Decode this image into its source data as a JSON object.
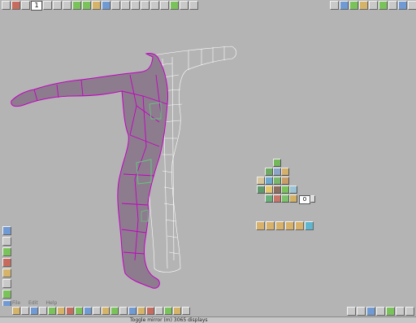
{
  "top_toolbar": {
    "frame_value": "1",
    "right_icons": [
      "perspective-view-icon",
      "camera-icon",
      "paint-icon",
      "render-icon",
      "texture-icon",
      "light-icon",
      "cube-icon",
      "grid-icon",
      "view-icon",
      "settings-icon",
      "close-icon"
    ]
  },
  "bottom_toolbar": {
    "menu_items": [
      "File",
      "Edit",
      "Help"
    ],
    "status": "Toggle mirror (m) 3065 displays"
  },
  "shelf_panel": {
    "input_value": "0"
  },
  "colors": {
    "background": "#b4b4b4",
    "mesh_fill": "#8d7c8e",
    "mesh_edges": "#c400c4",
    "mesh_highlight": "#62c87a",
    "mirror_wire": "#ffffff"
  }
}
